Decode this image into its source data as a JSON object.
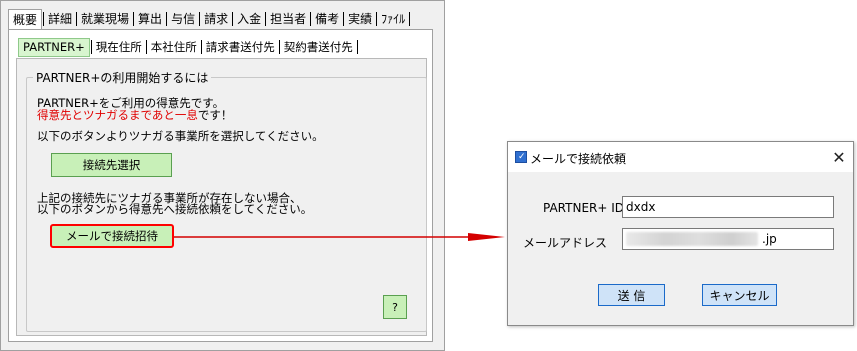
{
  "main_tabs": [
    "概要",
    "詳細",
    "就業現場",
    "算出",
    "与信",
    "請求",
    "入金",
    "担当者",
    "備考",
    "実績",
    "ﾌｧｲﾙ"
  ],
  "sub_tabs": [
    "PARTNER+",
    "現在住所",
    "本社住所",
    "請求書送付先",
    "契約書送付先"
  ],
  "group": {
    "title": "PARTNER+の利用開始するには",
    "line1": "PARTNER+をご利用の得意先です。",
    "line2_red": "得意先とツナガるまであと一息",
    "line2_black": "です！",
    "line3": "以下のボタンよりツナガる事業所を選択してください。",
    "select_button": "接続先選択",
    "line4": "上記の接続先にツナガる事業所が存在しない場合、",
    "line5": "以下のボタンから得意先へ接続依頼をしてください。",
    "mail_button": "メールで接続招待",
    "help_button": "?"
  },
  "dialog": {
    "title": "メールで接続依頼",
    "id_label": "PARTNER+ ID",
    "id_value": "dxdx",
    "email_label": "メールアドレス",
    "email_suffix": ".jp",
    "send_button": "送 信",
    "cancel_button": "キャンセル"
  },
  "colors": {
    "button_green": "#c8f0b8",
    "active_subtab": "#d8f5cf",
    "highlight_red": "#ff0000",
    "dialog_button": "#cfe3f8"
  }
}
